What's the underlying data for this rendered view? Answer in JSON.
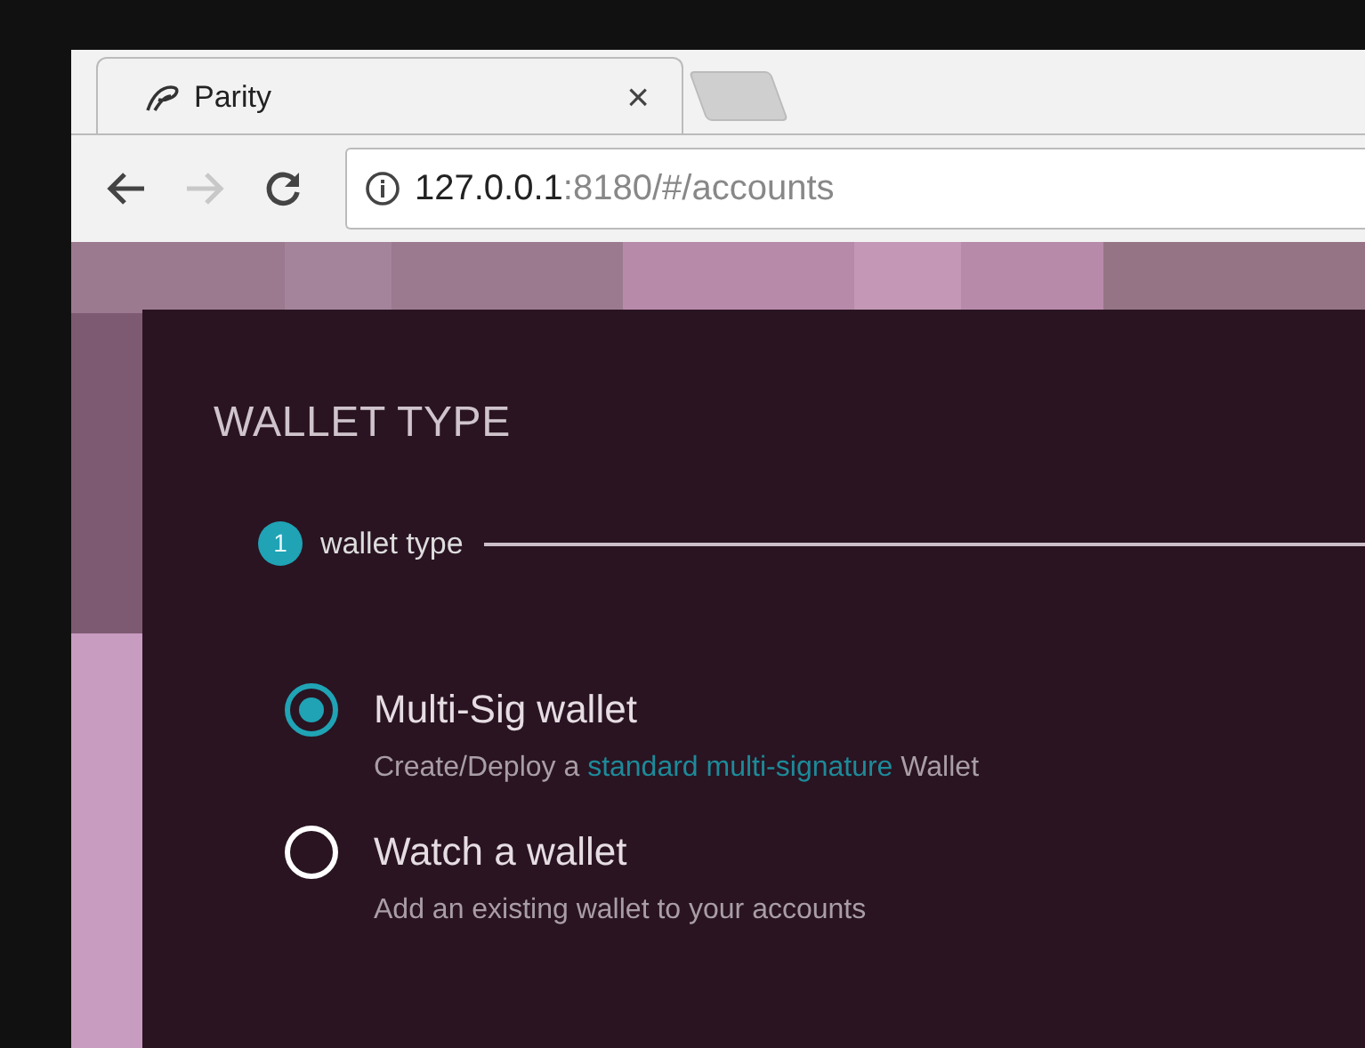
{
  "browser": {
    "tab": {
      "title": "Parity",
      "close": "×"
    },
    "url": {
      "host": "127.0.0.1",
      "rest": ":8180/#/accounts"
    }
  },
  "dialog": {
    "title": "WALLET TYPE",
    "steps": [
      {
        "number": "1",
        "label": "wallet type",
        "selected": true
      }
    ],
    "options": [
      {
        "label": "Multi-Sig wallet",
        "selected": true,
        "description": {
          "before": "Create/Deploy a ",
          "link": "standard multi-signature",
          "after": " Wallet"
        }
      },
      {
        "label": "Watch a wallet",
        "selected": false,
        "description": {
          "before": "Add an existing wallet to your accounts"
        }
      }
    ]
  }
}
